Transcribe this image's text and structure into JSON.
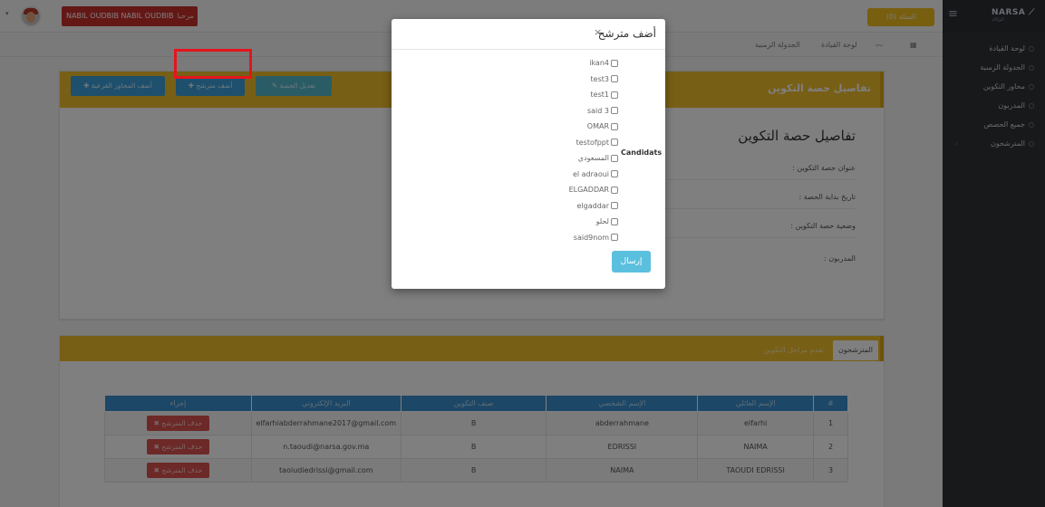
{
  "topbar": {
    "user_name": "NABIL OUDBIB NABIL OUDBIB",
    "greeting": "مرحبا",
    "cart_label": "السلة (0)"
  },
  "sidebar": {
    "logo": "NARSA",
    "logo_sub": "الوكالة",
    "items": [
      {
        "label": "لوحة القيادة"
      },
      {
        "label": "الجدولة الزمنية"
      },
      {
        "label": "محاور التكوين"
      },
      {
        "label": "المدربون"
      },
      {
        "label": "جميع الحصص"
      },
      {
        "label": "المترشحون"
      }
    ]
  },
  "breadcrumb": {
    "dashboard": "لوحة القيادة",
    "schedule": "الجدولة الزمنية"
  },
  "detail_panel": {
    "header_title": "تفاصيل حصة التكوين",
    "btn_add_subthemes": "أضف المحاور الفرعية",
    "btn_add_candidate": "أضف مترشح",
    "btn_edit_session": "تعديل الحصة",
    "title": "تفاصيل حصة التكوين",
    "fields": [
      {
        "label": "عنوان حصة التكوين :"
      },
      {
        "label": "تاريخ بداية الحصة :"
      },
      {
        "label": "وضعية حصة التكوين :"
      },
      {
        "label": "المدربون :"
      }
    ]
  },
  "candidates_panel": {
    "tab_candidates": "المترشحون",
    "tab_progress": "تقدم مراحل التكوين",
    "columns": [
      "#",
      "الإسم العائلي",
      "الإسم الشخصي",
      "صنف التكوين",
      "البريد الإلكتروني",
      "إجراء"
    ],
    "rows": [
      {
        "num": "1",
        "last": "elfarhi",
        "first": "abderrahmane",
        "category": "B",
        "email": "elfarhiabderrahmane2017@gmail.com",
        "action": "حذف المترشح"
      },
      {
        "num": "2",
        "last": "NAIMA",
        "first": "EDRISSI",
        "category": "B",
        "email": "n.taoudi@narsa.gov.ma",
        "action": "حذف المترشح"
      },
      {
        "num": "3",
        "last": "TAOUDI EDRISSI",
        "first": "NAIMA",
        "category": "B",
        "email": "taoiudiedrissi@gmail.com",
        "action": "حذف المترشح"
      }
    ]
  },
  "modal": {
    "title": "أضف مترشح",
    "close": "×",
    "field_label": "Candidats",
    "candidates": [
      "ikan4",
      "test3",
      "test1",
      "said 3",
      "OMAR",
      "testofppt",
      "المسعودي",
      "el adraoui",
      "ELGADDAR",
      "elgaddar",
      "لحلو",
      "said9nom"
    ],
    "submit": "إرسال"
  },
  "colors": {
    "accent_yellow": "#f1bf2c",
    "primary_blue": "#3a8fcc",
    "danger_red": "#d9534f",
    "highlight_red": "#e6141c",
    "sidebar_bg": "#2e3236"
  }
}
